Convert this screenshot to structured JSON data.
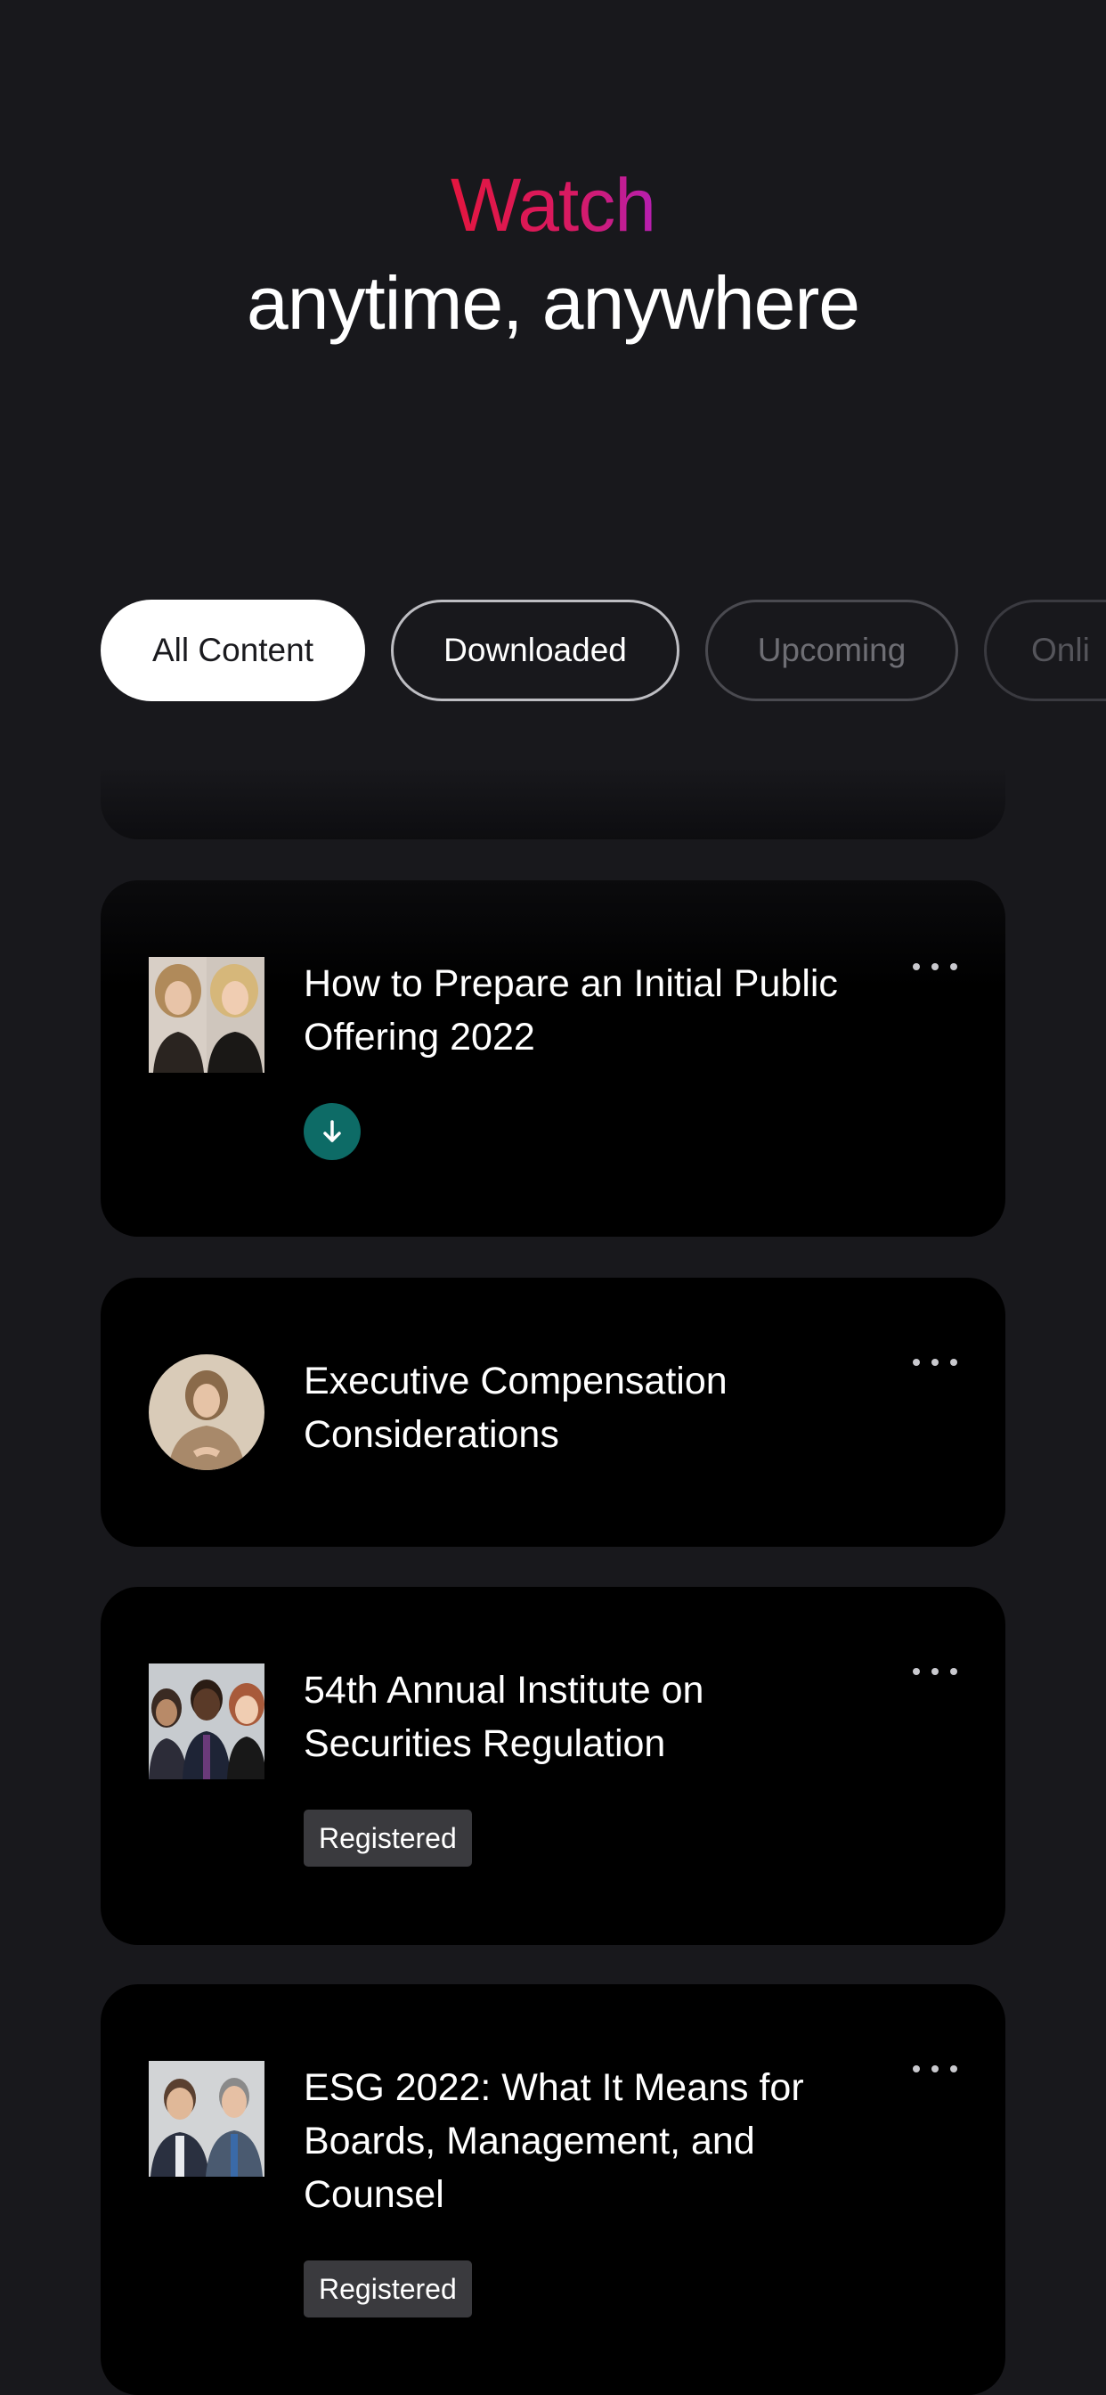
{
  "hero": {
    "accent_text": "Watch",
    "main_text": "anytime, anywhere",
    "gradient_colors": [
      "#e3163f",
      "#b51fb2"
    ]
  },
  "filters": [
    {
      "label": "All Content",
      "state": "selected"
    },
    {
      "label": "Downloaded",
      "state": "outlined"
    },
    {
      "label": "Upcoming",
      "state": "dim"
    },
    {
      "label": "Onli",
      "state": "dim-partial"
    }
  ],
  "cards": [
    {
      "title": "How to Prepare an Initial Public Offering 2022",
      "thumbnail": "two-presenters-photo",
      "status_icon": "download-icon",
      "status_color": "#0d6b66"
    },
    {
      "title": "Executive Compensation Considerations",
      "thumbnail": "single-presenter-round-photo"
    },
    {
      "title": "54th Annual Institute on Securities Regulation",
      "thumbnail": "three-presenters-photo",
      "tag": "Registered"
    },
    {
      "title": "ESG 2022: What It Means for Boards, Management, and Counsel",
      "thumbnail": "two-presenters-photo",
      "tag": "Registered"
    }
  ],
  "colors": {
    "background": "#18181c",
    "card": "#000000",
    "tag_background": "#3a3a3e"
  }
}
